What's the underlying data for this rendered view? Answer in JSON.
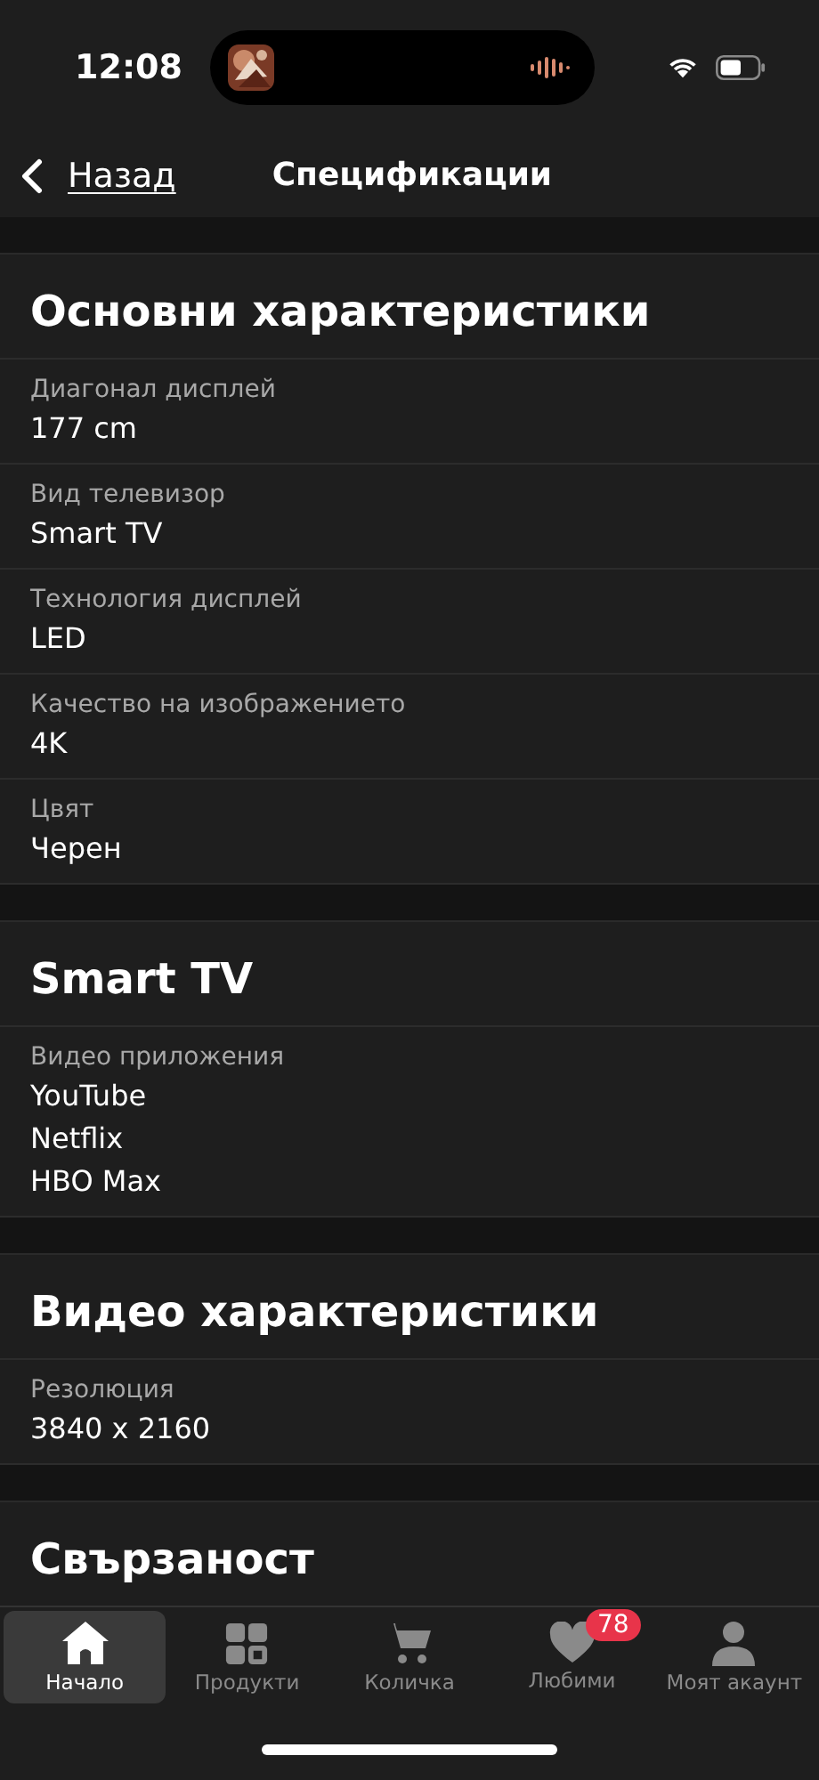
{
  "status_bar": {
    "time": "12:08"
  },
  "nav": {
    "back_label": "Назад",
    "title": "Спецификации"
  },
  "sections": [
    {
      "title": "Основни характеристики",
      "rows": [
        {
          "label": "Диагонал дисплей",
          "values": [
            "177 cm"
          ]
        },
        {
          "label": "Вид телевизор",
          "values": [
            "Smart TV"
          ]
        },
        {
          "label": "Технология дисплей",
          "values": [
            "LED"
          ]
        },
        {
          "label": "Качество на изображението",
          "values": [
            "4K"
          ]
        },
        {
          "label": "Цвят",
          "values": [
            "Черен"
          ]
        }
      ]
    },
    {
      "title": "Smart TV",
      "rows": [
        {
          "label": "Видео приложения",
          "values": [
            "YouTube",
            "Netflix",
            "HBO Max"
          ]
        }
      ]
    },
    {
      "title": "Видео характеристики",
      "rows": [
        {
          "label": "Резолюция",
          "values": [
            "3840 x 2160"
          ]
        }
      ]
    },
    {
      "title": "Свързаност"
    }
  ],
  "tab_bar": {
    "items": [
      {
        "kind": "home",
        "label": "Начало",
        "selected": true
      },
      {
        "kind": "grid",
        "label": "Продукти",
        "selected": false
      },
      {
        "kind": "cart",
        "label": "Количка",
        "selected": false
      },
      {
        "kind": "heart",
        "label": "Любими",
        "selected": false,
        "badge": "78"
      },
      {
        "kind": "person",
        "label": "Моят акаунт",
        "selected": false
      }
    ]
  }
}
